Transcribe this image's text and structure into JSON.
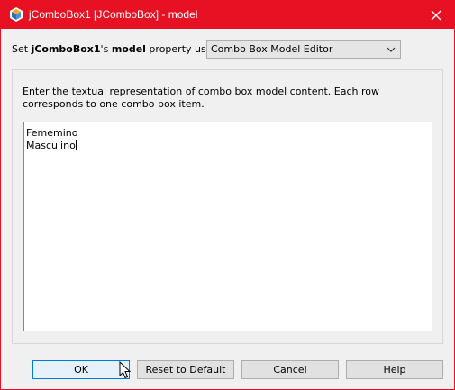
{
  "window": {
    "title": "jComboBox1 [JComboBox] - model"
  },
  "property_row": {
    "prefix": "Set ",
    "component": "jComboBox1",
    "possessive": "'s ",
    "property": "model",
    "suffix": " property using:",
    "editor_selected": "Combo Box Model Editor"
  },
  "editor": {
    "instructions": "Enter the textual representation of combo box model content. Each row corresponds to one combo box item.",
    "lines": [
      "Fememino",
      "Masculino"
    ]
  },
  "buttons": {
    "ok": "OK",
    "reset": "Reset to Default",
    "cancel": "Cancel",
    "help": "Help"
  },
  "colors": {
    "titlebar": "#e81123",
    "ok_border": "#0078d7"
  }
}
